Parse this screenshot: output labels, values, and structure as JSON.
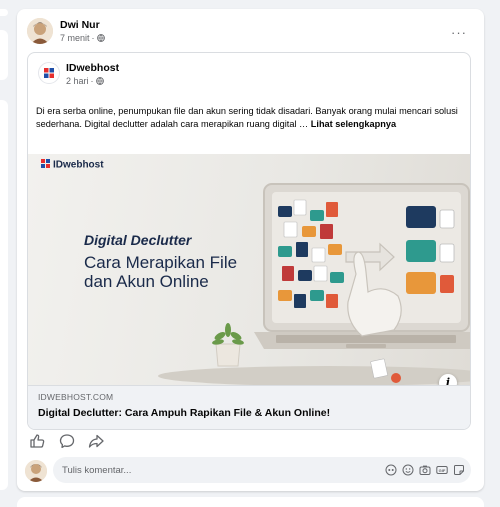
{
  "post": {
    "author": "Dwi Nur",
    "time": "7 menit",
    "more_label": "···"
  },
  "shared": {
    "page_name": "IDwebhost",
    "time": "2 hari",
    "text": "Di era serba online, penumpukan file dan akun sering tidak disadari. Banyak orang mulai mencari solusi sederhana. Digital declutter adalah cara merapikan ruang digital …",
    "see_more": "Lihat selengkapnya"
  },
  "banner": {
    "logo_text": "IDwebhost",
    "kicker": "Digital Declutter",
    "headline_line1": "Cara Merapikan File",
    "headline_line2": "dan Akun Online"
  },
  "link": {
    "domain": "IDWEBHOST.COM",
    "title": "Digital Declutter: Cara Ampuh Rapikan File & Akun Online!",
    "info_label": "i"
  },
  "actions": {
    "like_icon": "thumbs-up-icon",
    "comment_icon": "comment-bubble-icon",
    "share_icon": "share-arrow-icon"
  },
  "comment": {
    "placeholder": "Tulis komentar...",
    "icons": [
      "avatar-sticker-icon",
      "emoji-icon",
      "camera-icon",
      "gif-icon",
      "sticker-icon"
    ]
  },
  "colors": {
    "brand_blue": "#1877f2",
    "logo_red": "#e62e2e",
    "logo_blue": "#1f4fa8",
    "folder_navy": "#1e3a5f",
    "folder_teal": "#2e9a8e",
    "folder_orange": "#e8973a"
  }
}
